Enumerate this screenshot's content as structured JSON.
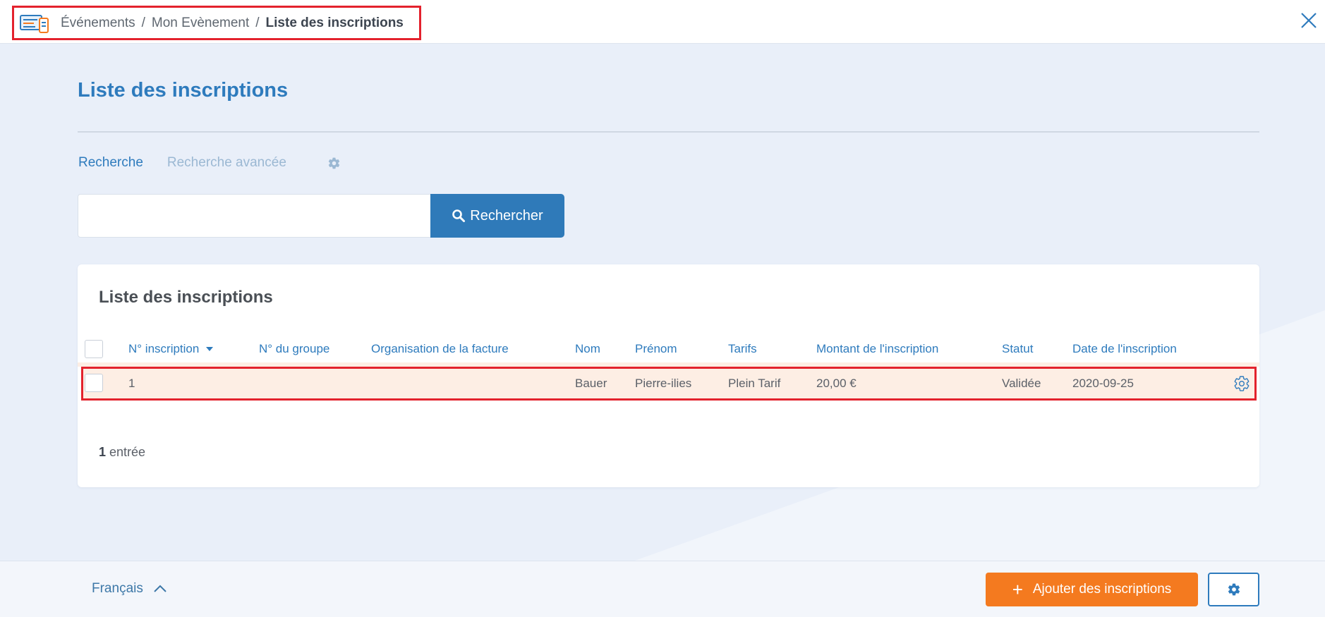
{
  "breadcrumb": {
    "items": [
      "Événements",
      "Mon Evènement",
      "Liste des inscriptions"
    ],
    "separator": "/"
  },
  "page": {
    "title": "Liste des inscriptions"
  },
  "tabs": {
    "search": "Recherche",
    "advanced": "Recherche avancée"
  },
  "search": {
    "value": "",
    "placeholder": "",
    "button_label": "Rechercher"
  },
  "card": {
    "title": "Liste des inscriptions",
    "columns": [
      "N° inscription",
      "N° du groupe",
      "Organisation de la facture",
      "Nom",
      "Prénom",
      "Tarifs",
      "Montant de l'inscription",
      "Statut",
      "Date de l'inscription"
    ],
    "sort_icon": "caret-down-icon",
    "rows": [
      {
        "numero": "1",
        "groupe": "",
        "organisation": "",
        "nom": "Bauer",
        "prenom": "Pierre-ilies",
        "tarif": "Plein Tarif",
        "montant": "20,00 €",
        "statut": "Validée",
        "date": "2020-09-25"
      }
    ],
    "count_number": "1",
    "count_label": "entrée"
  },
  "footer": {
    "language": "Français",
    "add_button": "Ajouter des inscriptions"
  },
  "colors": {
    "primary": "#2e7bbd",
    "accent": "#f47a1f",
    "highlight_row": "#fdeee4",
    "annotation_red": "#e3222d"
  }
}
